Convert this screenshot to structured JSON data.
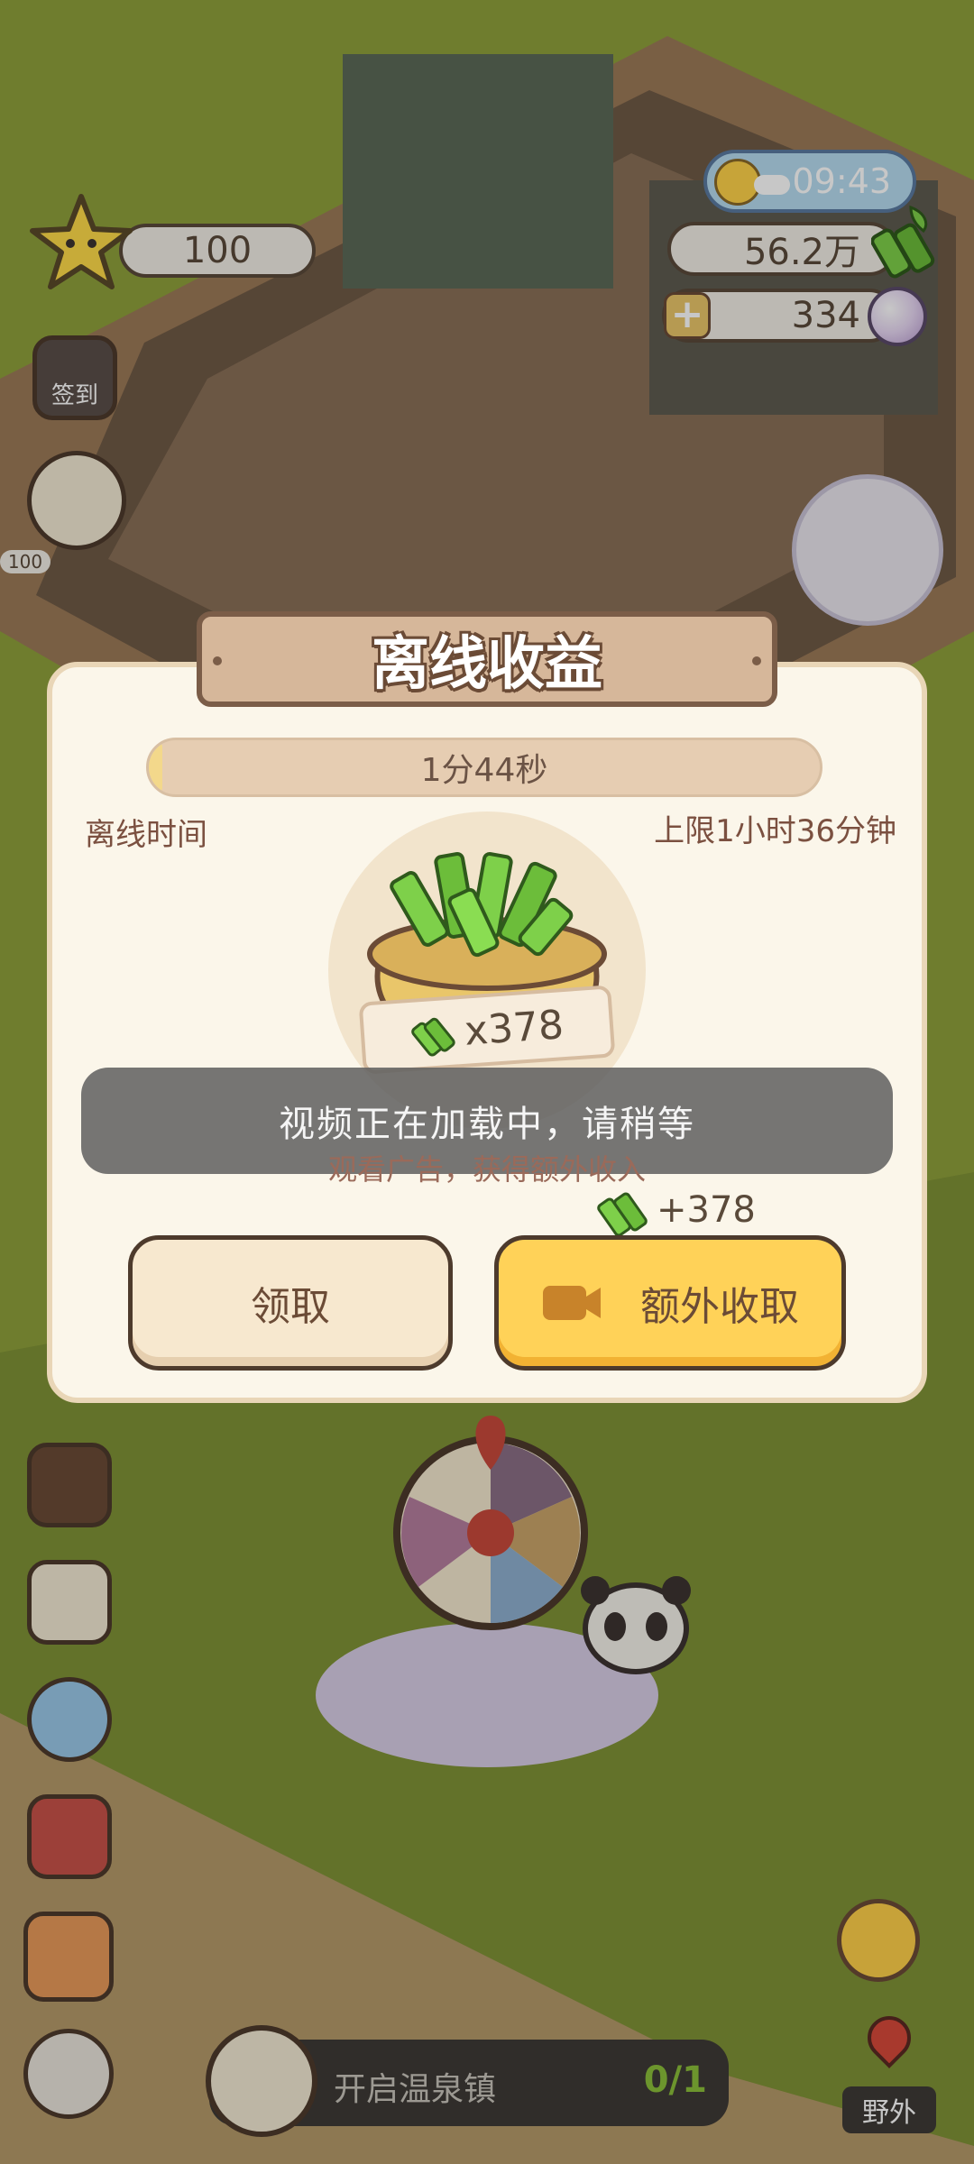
{
  "hud": {
    "time": "09:43",
    "stars": "100",
    "bamboo": "56.2万",
    "pearls": "334",
    "checkin_label": "签到",
    "side_badge": "100"
  },
  "dialog": {
    "title": "离线收益",
    "progress_text": "1分44秒",
    "progress_fraction": 0.02,
    "offline_time_label": "离线时间",
    "limit_label": "上限1小时36分钟",
    "reward_amount": "x378",
    "toast": "视频正在加载中，请稍等",
    "ad_hint": "观看广告，获得额外收入",
    "bonus_amount": "+378",
    "claim_label": "领取",
    "extra_label": "额外收取"
  },
  "quest": {
    "label": "开启温泉镇",
    "progress": "0/1"
  },
  "map_label": "野外",
  "icons": [
    "star-icon",
    "bamboo-icon",
    "pearl-icon",
    "plus-icon",
    "sun-icon",
    "cloud-icon",
    "video-icon",
    "map-pin-icon",
    "scroll-icon",
    "paw-icon",
    "magnifier-icon",
    "book-icon",
    "shirt-icon",
    "mushroom-house-icon",
    "wheel-icon",
    "panda-icon",
    "npc-avatar-icon",
    "emoji-face-icon",
    "bamboo-bag-icon"
  ],
  "colors": {
    "accent": "#ffd258",
    "panel": "#fbf6ea",
    "title_plate": "#d6b79a",
    "text_brown": "#6b4b36"
  }
}
